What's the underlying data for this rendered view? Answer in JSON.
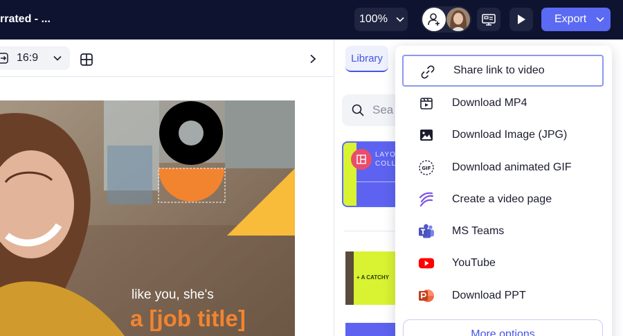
{
  "topbar": {
    "doc_title": "rrated - ...",
    "zoom": "100%",
    "export_label": "Export"
  },
  "toolbar": {
    "aspect_ratio": "16:9"
  },
  "slide": {
    "line1": "like you, she's",
    "line2": "a [job title]"
  },
  "library": {
    "tab_label": "Library",
    "search_placeholder": "Sea",
    "thumb1_text": "LAYO\nCOLL",
    "thumb2_text": "+ A CATCHY"
  },
  "export_menu": {
    "items": [
      {
        "label": "Share link to video",
        "icon": "link-icon"
      },
      {
        "label": "Download MP4",
        "icon": "video-file-icon"
      },
      {
        "label": "Download Image (JPG)",
        "icon": "image-icon"
      },
      {
        "label": "Download animated GIF",
        "icon": "gif-icon"
      },
      {
        "label": "Create a video page",
        "icon": "video-page-icon"
      },
      {
        "label": "MS Teams",
        "icon": "ms-teams-icon"
      },
      {
        "label": "YouTube",
        "icon": "youtube-icon"
      },
      {
        "label": "Download PPT",
        "icon": "powerpoint-icon"
      }
    ],
    "more_label": "More options"
  },
  "colors": {
    "topbar_bg": "#0e1330",
    "accent": "#5b6af3",
    "slide_orange": "#f28430",
    "slide_yellow": "#f8bb3a"
  }
}
